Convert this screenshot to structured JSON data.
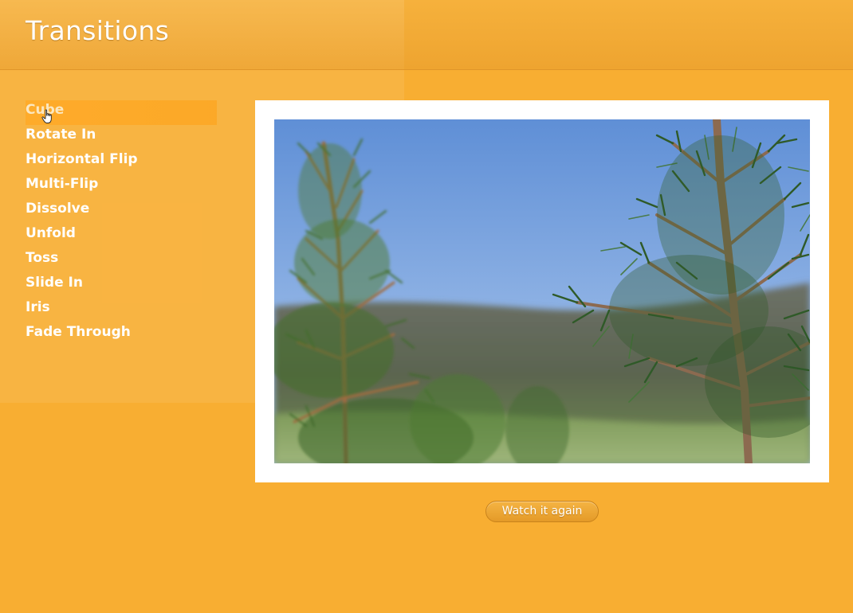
{
  "header": {
    "title": "Transitions"
  },
  "sidebar": {
    "items": [
      {
        "label": "Cube",
        "active": true
      },
      {
        "label": "Rotate In"
      },
      {
        "label": "Horizontal Flip"
      },
      {
        "label": "Multi-Flip"
      },
      {
        "label": "Dissolve"
      },
      {
        "label": "Unfold"
      },
      {
        "label": "Toss"
      },
      {
        "label": "Slide In"
      },
      {
        "label": "Iris"
      },
      {
        "label": "Fade Through"
      }
    ]
  },
  "main": {
    "watch_again_label": "Watch it again"
  },
  "colors": {
    "background": "#f8ae32",
    "accent": "#e49a28",
    "frame": "#ffffff"
  },
  "icons": {
    "cursor": "hand-pointer-icon"
  }
}
